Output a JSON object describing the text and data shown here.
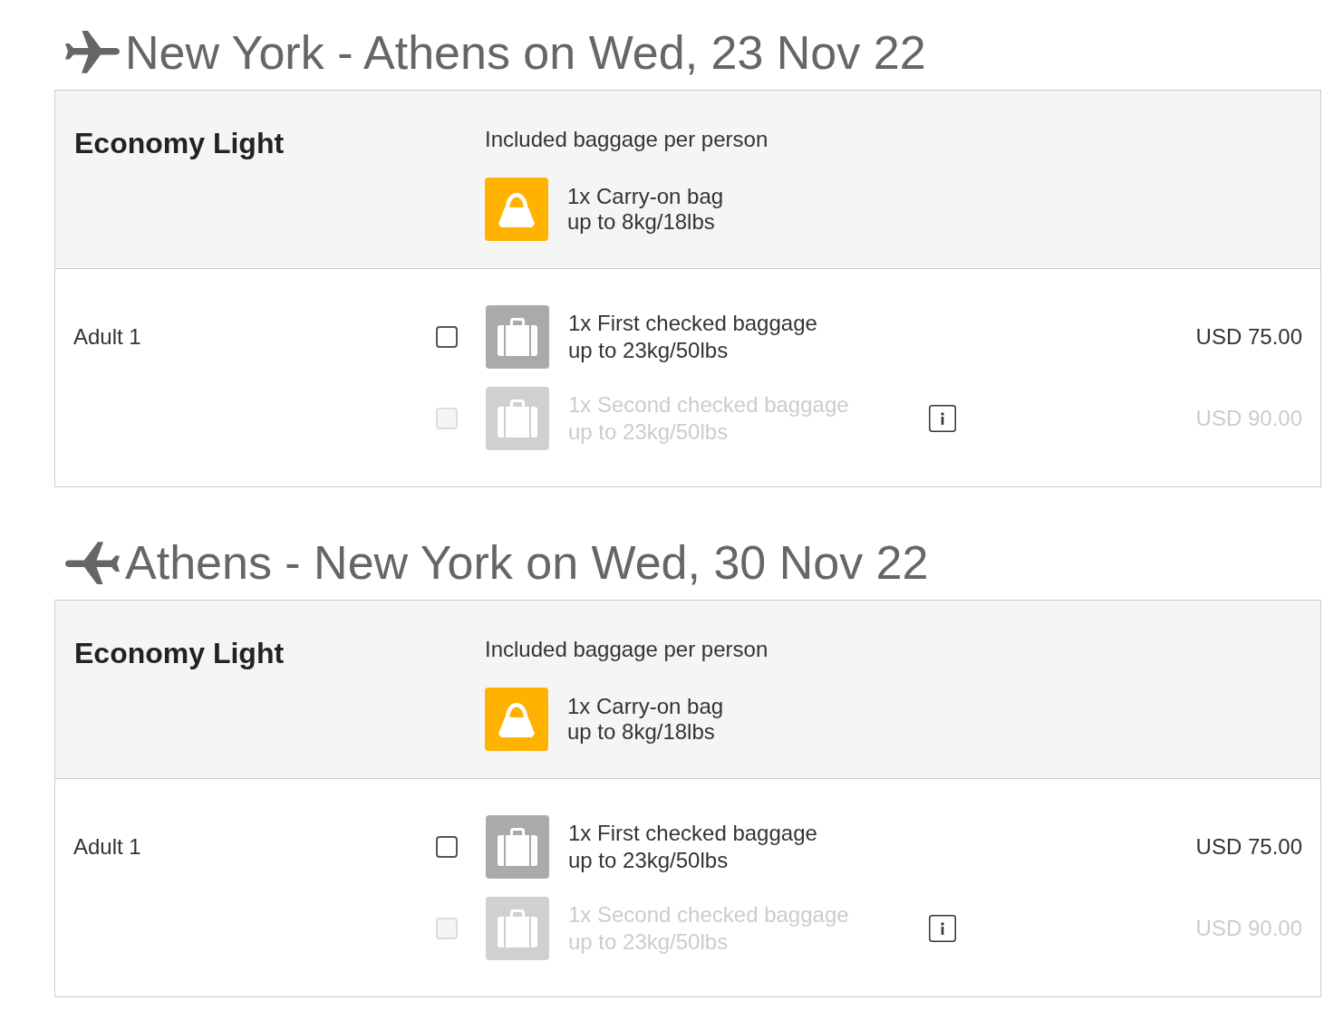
{
  "flights": [
    {
      "kind": "outbound",
      "title": "New York - Athens on Wed, 23 Nov 22",
      "fare": {
        "name": "Economy Light",
        "included_heading": "Included baggage per person",
        "included": [
          {
            "kind": "carry_on",
            "name": "1x Carry-on bag",
            "limit": "up to 8kg/18lbs"
          }
        ]
      },
      "passengers": [
        {
          "label": "Adult 1",
          "options": [
            {
              "kind": "checked_bag",
              "name": "1x First checked baggage",
              "limit": "up to 23kg/50lbs",
              "price": "USD 75.00",
              "checked": false,
              "disabled": false,
              "info": false
            },
            {
              "kind": "checked_bag",
              "name": "1x Second checked baggage",
              "limit": "up to 23kg/50lbs",
              "price": "USD 90.00",
              "checked": false,
              "disabled": true,
              "info": true
            }
          ]
        }
      ]
    },
    {
      "kind": "return",
      "title": "Athens - New York on Wed, 30 Nov 22",
      "fare": {
        "name": "Economy Light",
        "included_heading": "Included baggage per person",
        "included": [
          {
            "kind": "carry_on",
            "name": "1x Carry-on bag",
            "limit": "up to 8kg/18lbs"
          }
        ]
      },
      "passengers": [
        {
          "label": "Adult 1",
          "options": [
            {
              "kind": "checked_bag",
              "name": "1x First checked baggage",
              "limit": "up to 23kg/50lbs",
              "price": "USD 75.00",
              "checked": false,
              "disabled": false,
              "info": false
            },
            {
              "kind": "checked_bag",
              "name": "1x Second checked baggage",
              "limit": "up to 23kg/50lbs",
              "price": "USD 90.00",
              "checked": false,
              "disabled": true,
              "info": true
            }
          ]
        }
      ]
    }
  ]
}
